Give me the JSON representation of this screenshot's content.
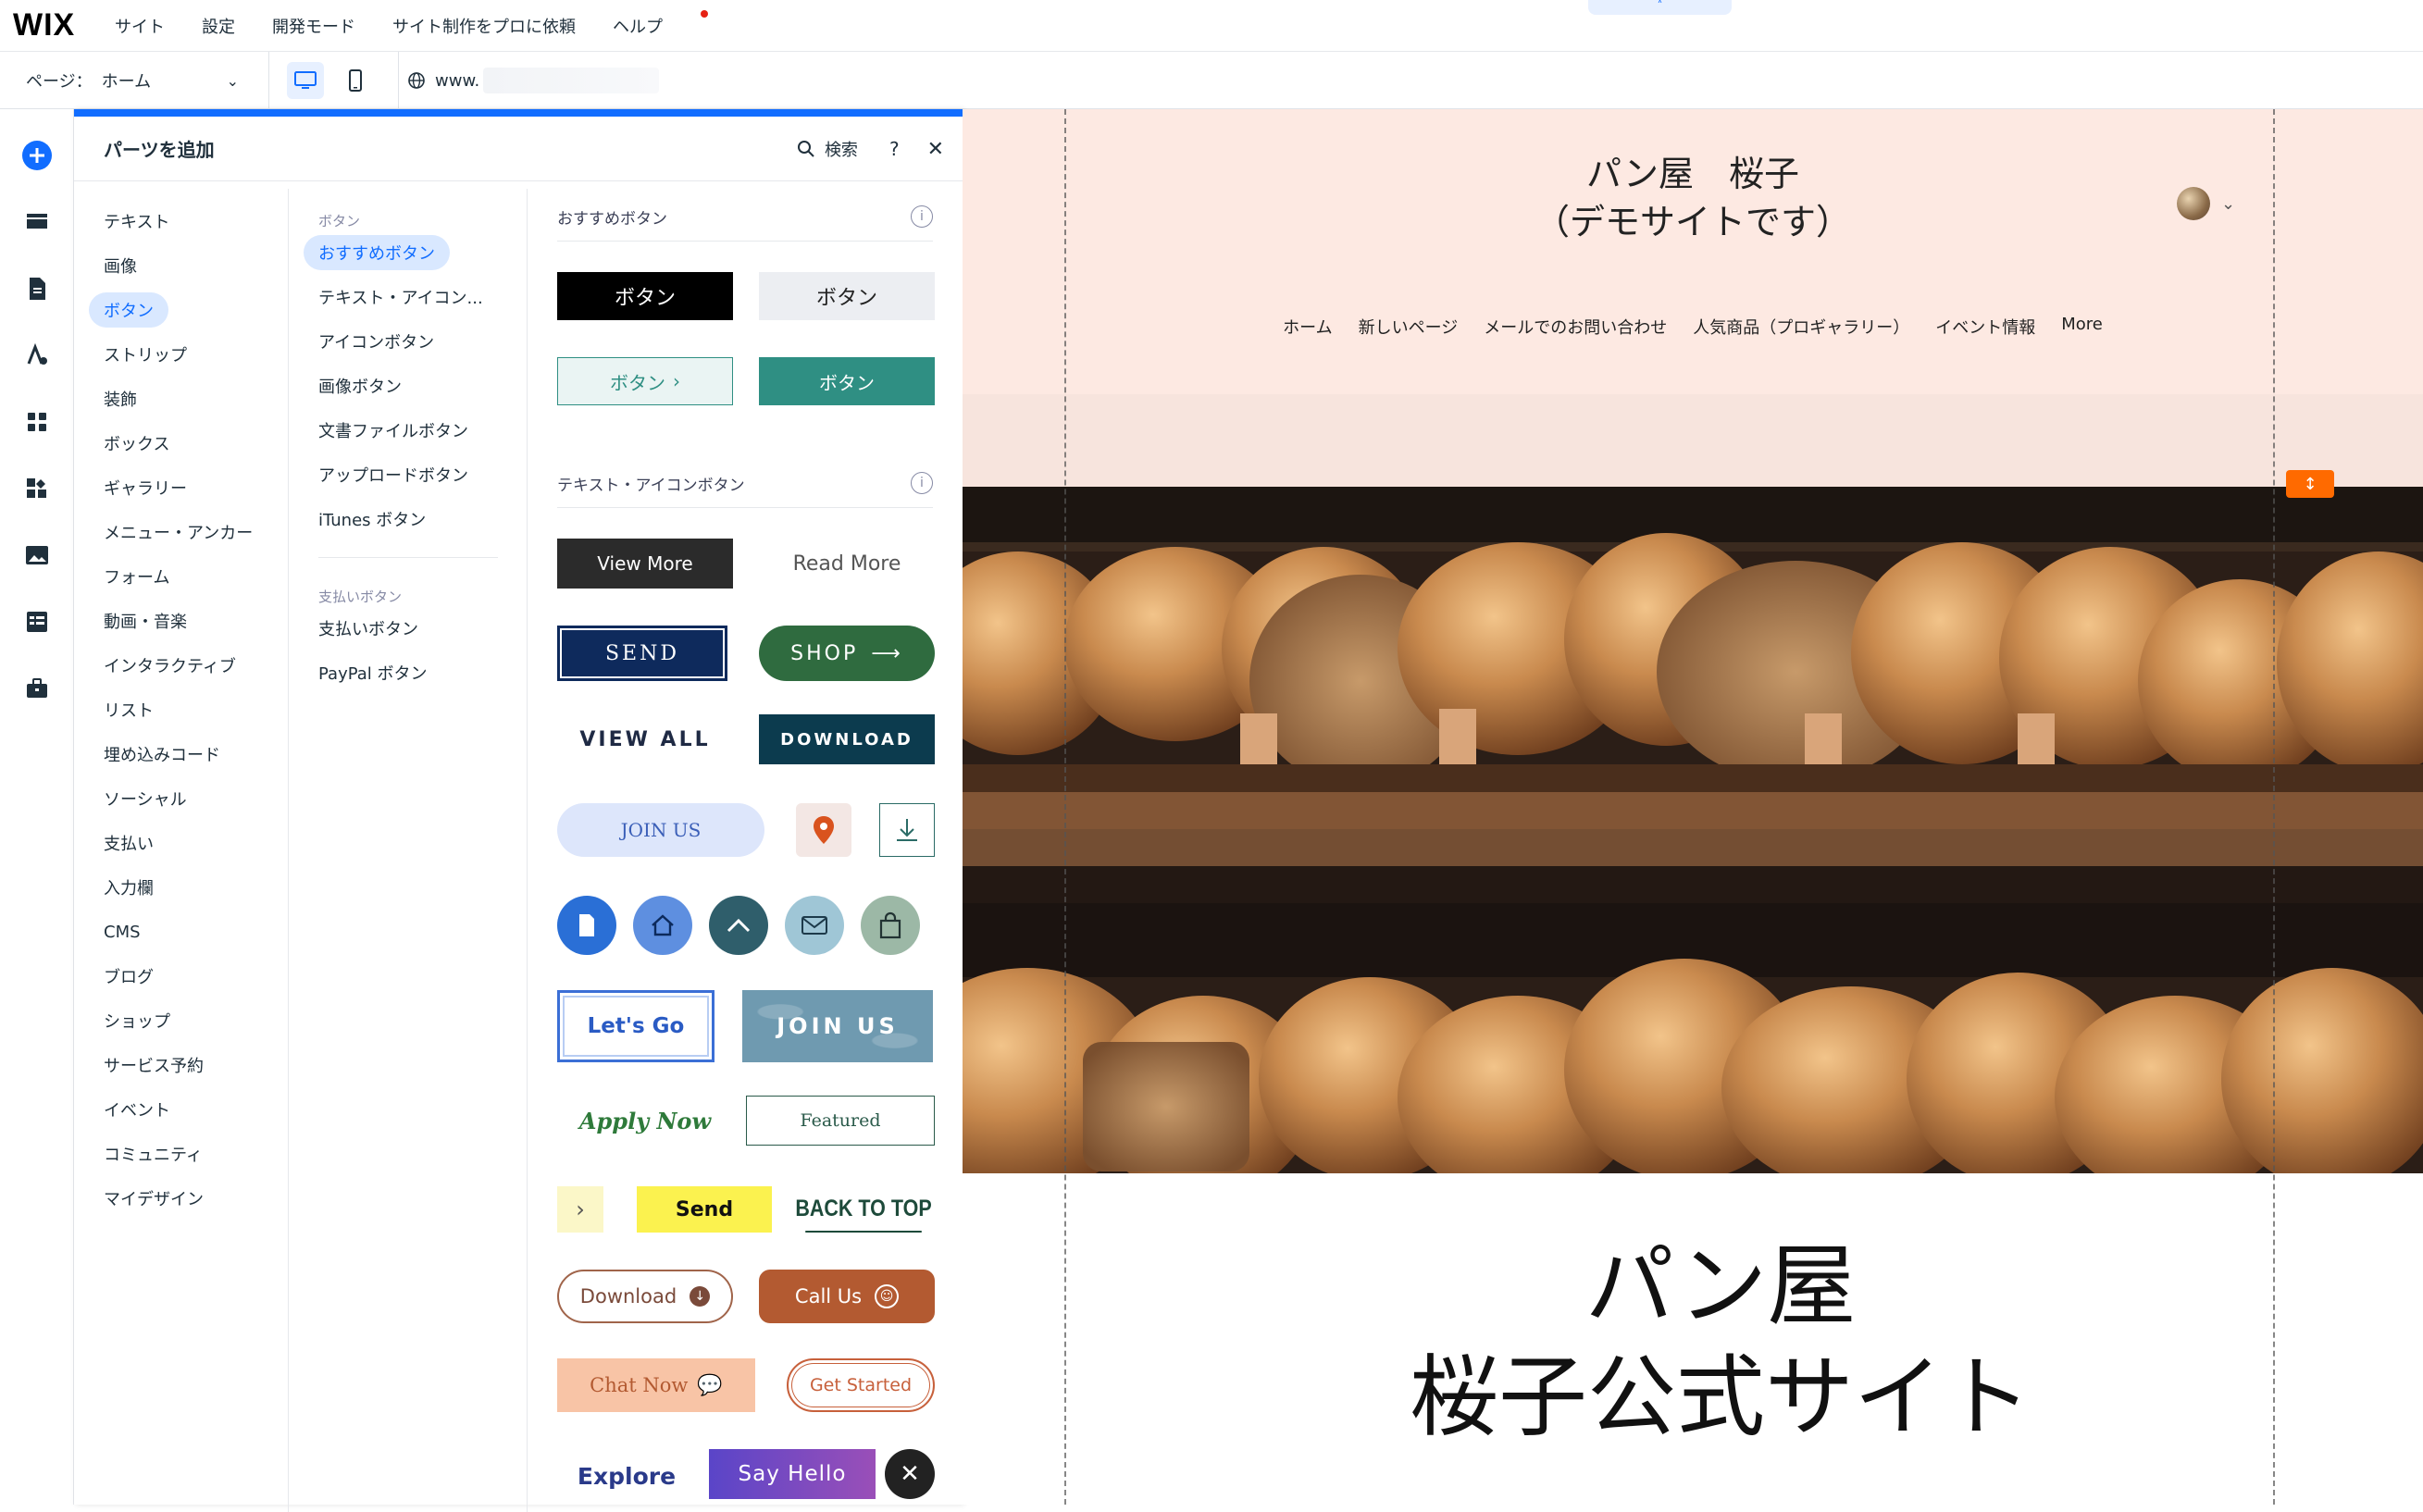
{
  "topbar": {
    "logo": "WIX",
    "menu": [
      "サイト",
      "設定",
      "開発モード",
      "サイト制作をプロに依頼",
      "ヘルプ"
    ],
    "collapse_icon": "chevron-up-icon"
  },
  "secondbar": {
    "page_label": "ページ：",
    "page_value": "ホーム",
    "url_prefix": "www."
  },
  "panel": {
    "title": "パーツを追加",
    "search_label": "検索",
    "help_label": "?",
    "categories": [
      "テキスト",
      "画像",
      "ボタン",
      "ストリップ",
      "装飾",
      "ボックス",
      "ギャラリー",
      "メニュー・アンカー",
      "フォーム",
      "動画・音楽",
      "インタラクティブ",
      "リスト",
      "埋め込みコード",
      "ソーシャル",
      "支払い",
      "入力欄",
      "CMS",
      "ブログ",
      "ショップ",
      "サービス予約",
      "イベント",
      "コミュニティ",
      "マイデザイン"
    ],
    "active_category": "ボタン",
    "sub_heading_1": "ボタン",
    "sub_items_1": [
      "おすすめボタン",
      "テキスト・アイコン...",
      "アイコンボタン",
      "画像ボタン",
      "文書ファイルボタン",
      "アップロードボタン",
      "iTunes ボタン"
    ],
    "sub_heading_2": "支払いボタン",
    "sub_items_2": [
      "支払いボタン",
      "PayPal ボタン"
    ],
    "section_recommended": "おすすめボタン",
    "section_text_icon": "テキスト・アイコンボタン",
    "buttons": {
      "b1": "ボタン",
      "b2": "ボタン",
      "b3": "ボタン",
      "b4": "ボタン",
      "view_more": "View More",
      "read_more": "Read More",
      "send": "SEND",
      "shop": "SHOP",
      "view_all": "VIEW ALL",
      "download_caps": "DOWNLOAD",
      "join_us_pill": "JOIN US",
      "lets_go": "Let's Go",
      "join_us_leaf": "JOIN US",
      "apply_now": "Apply Now",
      "featured": "Featured",
      "send_yellow": "Send",
      "back_to_top": "BACK TO TOP",
      "download": "Download",
      "call_us": "Call Us",
      "chat_now": "Chat Now",
      "get_started": "Get Started",
      "explore": "Explore",
      "say_hello": "Say Hello"
    }
  },
  "site": {
    "title_line1": "パン屋　桜子",
    "title_line2": "（デモサイトです）",
    "nav": [
      "ホーム",
      "新しいページ",
      "メールでのお問い合わせ",
      "人気商品（プロギャラリー）",
      "イベント情報",
      "More"
    ],
    "heading_line1": "パン屋",
    "heading_line2": "桜子公式サイト"
  },
  "colors": {
    "accent": "#116dff",
    "header_bg": "#fde9e2",
    "handle": "#ff6a00"
  }
}
